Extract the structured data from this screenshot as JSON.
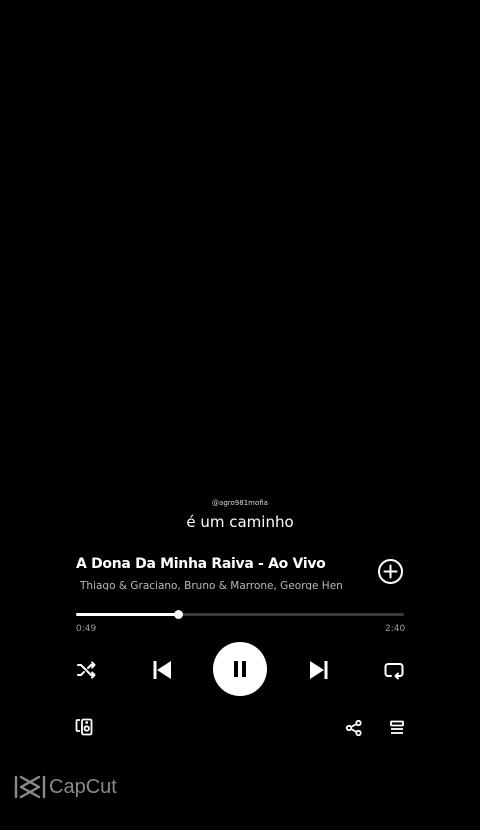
{
  "overlay": {
    "handle": "@agro981mofia",
    "lyric": "é um caminho"
  },
  "track": {
    "title": "A Dona Da Minha Raiva - Ao Vivo",
    "artists": "Thiago & Graciano, Bruno & Marrone, George Henrique & Rodrigo"
  },
  "progress": {
    "elapsed": "0:49",
    "total": "2:40",
    "fraction": 0.31
  },
  "controls": {
    "shuffle_icon": "shuffle-icon",
    "previous_icon": "skip-previous-icon",
    "play_state_icon": "pause-icon",
    "next_icon": "skip-next-icon",
    "repeat_icon": "repeat-icon",
    "add_icon": "add-circle-icon"
  },
  "footer": {
    "devices_icon": "connect-devices-icon",
    "share_icon": "share-icon",
    "queue_icon": "queue-icon"
  },
  "watermark": {
    "text": "CapCut"
  },
  "colors": {
    "background": "#000000",
    "primary": "#ffffff",
    "secondary": "#b8b8b8",
    "watermark": "#8a8a8a"
  }
}
